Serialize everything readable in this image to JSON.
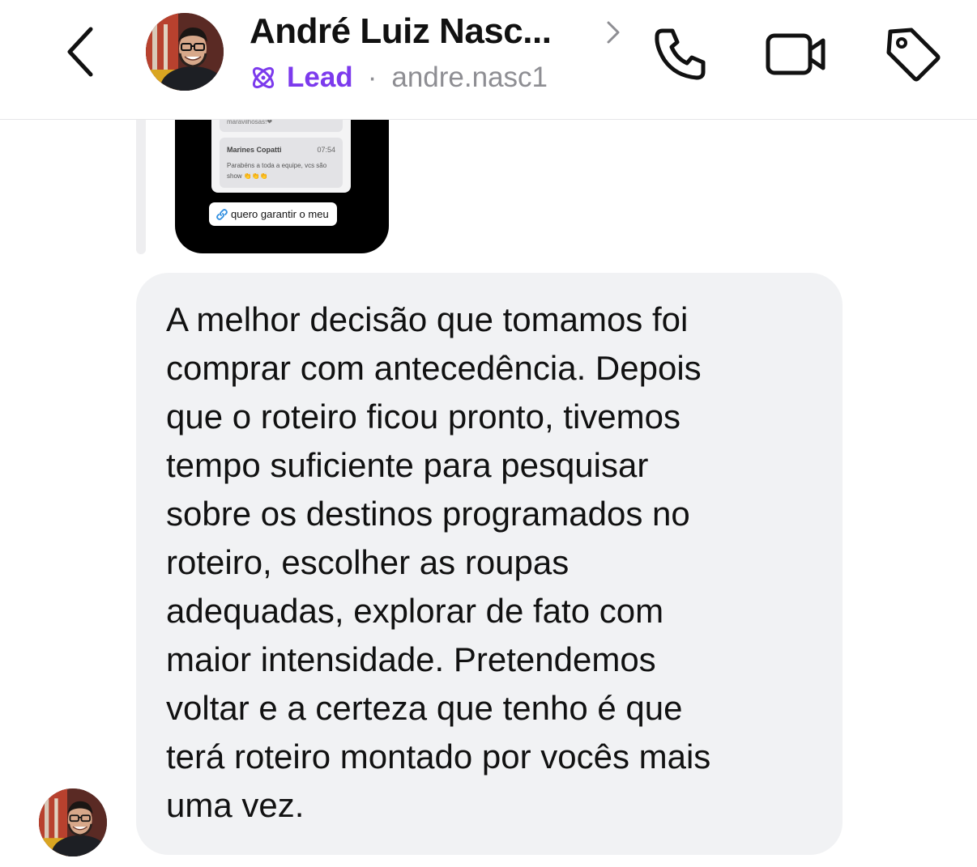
{
  "header": {
    "contact_name": "André Luiz Nasc...",
    "badge_label": "Lead",
    "separator": "·",
    "username": "andre.nasc1",
    "icons": {
      "back": "chevron-left-icon",
      "name_chevron": "chevron-right-icon",
      "badge": "atom-icon",
      "call": "phone-icon",
      "video": "video-camera-icon",
      "label": "tag-icon"
    },
    "accent_color": "#7c3aed"
  },
  "conversation": {
    "story_reply": {
      "cut_off_text": "maravilhosas!❤",
      "comment_author": "Marines Copatti",
      "comment_time": "07:54",
      "comment_text": "Parabéns a toda a equipe, vcs são show 👏👏👏",
      "link_label": "quero garantir o meu"
    },
    "message": {
      "text": "A melhor decisão que tomamos foi\ncomprar com antecedência. Depois\nque o roteiro ficou pronto, tivemos\ntempo suficiente para pesquisar\nsobre os destinos programados no\nroteiro, escolher as roupas\nadequadas, explorar de fato com\nmaior intensidade. Pretendemos\nvoltar e a certeza que tenho é que\nterá roteiro montado por vocês mais\numa vez."
    }
  }
}
